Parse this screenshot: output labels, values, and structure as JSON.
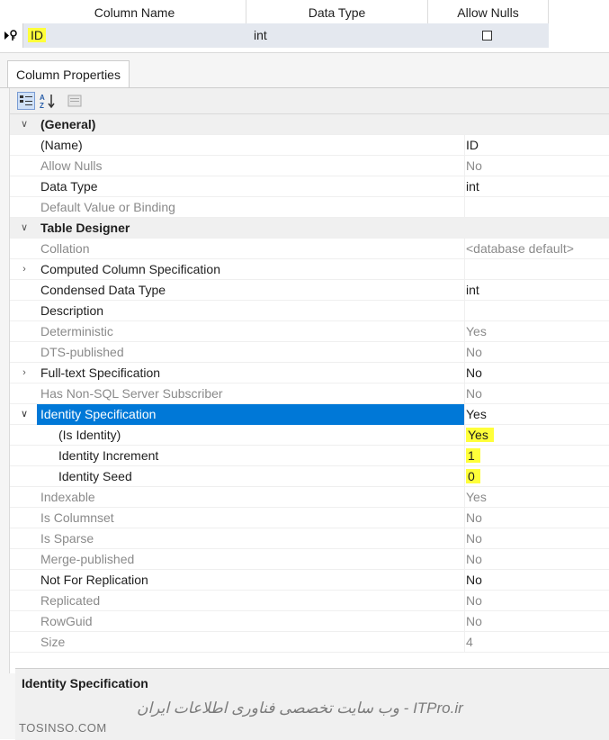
{
  "grid": {
    "columns": [
      "Column Name",
      "Data Type",
      "Allow Nulls"
    ],
    "row": {
      "column_name": "ID",
      "data_type": "int",
      "allow_nulls": false
    }
  },
  "panel": {
    "tab_label": "Column Properties",
    "toolbar": {
      "categorized_icon": "categorized-icon",
      "alphabetical_icon": "sort-az-icon",
      "pages_icon": "property-pages-icon"
    },
    "properties": [
      {
        "name": "(General)",
        "value": "",
        "kind": "category",
        "expander": "v"
      },
      {
        "name": "(Name)",
        "value": "ID",
        "kind": "normal"
      },
      {
        "name": "Allow Nulls",
        "value": "No",
        "kind": "readonly"
      },
      {
        "name": "Data Type",
        "value": "int",
        "kind": "normal"
      },
      {
        "name": "Default Value or Binding",
        "value": "",
        "kind": "readonly"
      },
      {
        "name": "Table Designer",
        "value": "",
        "kind": "category",
        "expander": "v"
      },
      {
        "name": "Collation",
        "value": "<database default>",
        "kind": "readonly"
      },
      {
        "name": "Computed Column Specification",
        "value": "",
        "kind": "normal",
        "expander": ">"
      },
      {
        "name": "Condensed Data Type",
        "value": "int",
        "kind": "normal"
      },
      {
        "name": "Description",
        "value": "",
        "kind": "normal"
      },
      {
        "name": "Deterministic",
        "value": "Yes",
        "kind": "readonly"
      },
      {
        "name": "DTS-published",
        "value": "No",
        "kind": "readonly"
      },
      {
        "name": "Full-text Specification",
        "value": "No",
        "kind": "normal",
        "expander": ">"
      },
      {
        "name": "Has Non-SQL Server Subscriber",
        "value": "No",
        "kind": "readonly"
      },
      {
        "name": "Identity Specification",
        "value": "Yes",
        "kind": "selected",
        "expander": "v"
      },
      {
        "name": "(Is Identity)",
        "value": "Yes",
        "kind": "child",
        "highlight": true
      },
      {
        "name": "Identity Increment",
        "value": "1",
        "kind": "child",
        "highlight": true
      },
      {
        "name": "Identity Seed",
        "value": "0",
        "kind": "child",
        "highlight": true
      },
      {
        "name": "Indexable",
        "value": "Yes",
        "kind": "readonly"
      },
      {
        "name": "Is Columnset",
        "value": "No",
        "kind": "readonly"
      },
      {
        "name": "Is Sparse",
        "value": "No",
        "kind": "readonly"
      },
      {
        "name": "Merge-published",
        "value": "No",
        "kind": "readonly"
      },
      {
        "name": "Not For Replication",
        "value": "No",
        "kind": "normal"
      },
      {
        "name": "Replicated",
        "value": "No",
        "kind": "readonly"
      },
      {
        "name": "RowGuid",
        "value": "No",
        "kind": "readonly"
      },
      {
        "name": "Size",
        "value": "4",
        "kind": "readonly"
      }
    ],
    "description": {
      "title": "Identity Specification",
      "watermark": "ITPro.ir - وب سایت تخصصی فناوری اطلاعات ایران",
      "logo": "TOSINSO.COM"
    }
  },
  "colors": {
    "selection": "#0078d7",
    "highlight": "#ffff3a",
    "grid_row": "#e4e8ef"
  }
}
